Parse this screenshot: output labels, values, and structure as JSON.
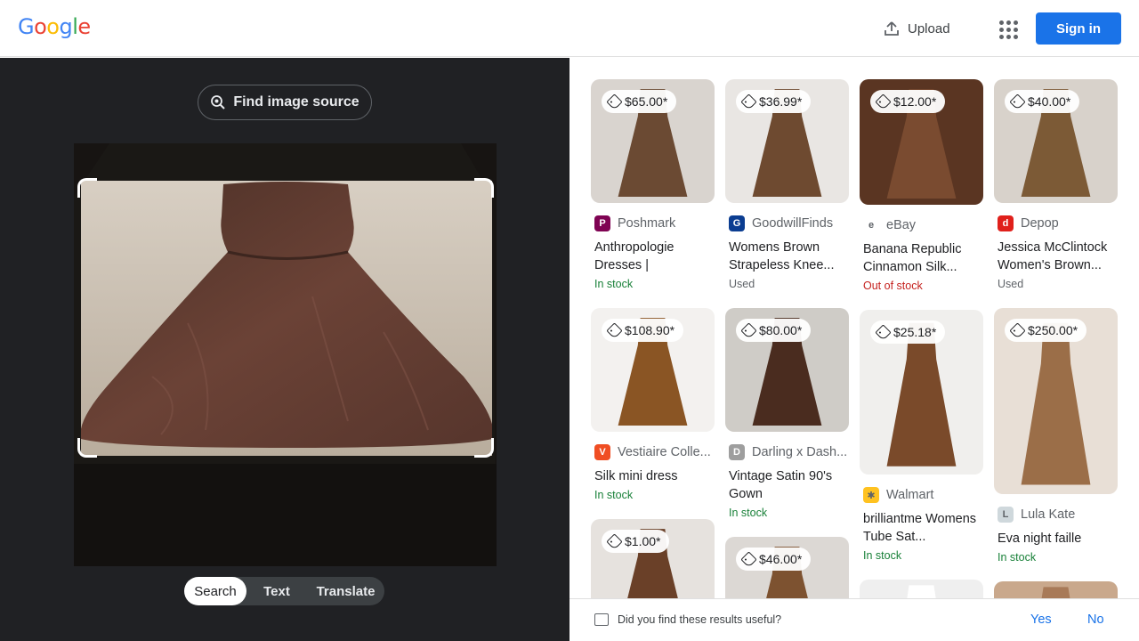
{
  "header": {
    "logo_letters": [
      {
        "ch": "G",
        "color": "#4285f4"
      },
      {
        "ch": "o",
        "color": "#ea4335"
      },
      {
        "ch": "o",
        "color": "#fbbc05"
      },
      {
        "ch": "g",
        "color": "#4285f4"
      },
      {
        "ch": "l",
        "color": "#34a853"
      },
      {
        "ch": "e",
        "color": "#ea4335"
      }
    ],
    "upload_label": "Upload",
    "apps_icon": "apps-grid-icon",
    "signin_label": "Sign in"
  },
  "left": {
    "find_source_label": "Find image source",
    "modes": [
      "Search",
      "Text",
      "Translate"
    ],
    "active_mode": "Search"
  },
  "results": [
    {
      "price": "$65.00*",
      "source": "Poshmark",
      "fav_color": "#7f0353",
      "fav_text": "P",
      "title": "Anthropologie Dresses |",
      "stock": "In stock",
      "stock_type": "in",
      "img": "#d9d4cf",
      "dress": "#6b4a33"
    },
    {
      "price": "$36.99*",
      "source": "GoodwillFinds",
      "fav_color": "#0b3d91",
      "fav_text": "G",
      "title": "Womens Brown Strapeless Knee...",
      "stock": "Used",
      "stock_type": "used",
      "img": "#e9e6e3",
      "dress": "#6e4a30"
    },
    {
      "price": "$12.00*",
      "source": "eBay",
      "fav_color": "#ffffff",
      "fav_text": "e",
      "title": "Banana Republic Cinnamon Silk...",
      "stock": "Out of stock",
      "stock_type": "out",
      "img": "#5a3522",
      "dress": "#7a4b30"
    },
    {
      "price": "$40.00*",
      "source": "Depop",
      "fav_color": "#e0201b",
      "fav_text": "d",
      "title": "Jessica McClintock Women's Brown...",
      "stock": "Used",
      "stock_type": "used",
      "img": "#d8d2cb",
      "dress": "#7c5a36"
    },
    {
      "price": "$108.90*",
      "source": "Vestiaire Colle...",
      "fav_color": "#f04e23",
      "fav_text": "V",
      "title": "Silk mini dress",
      "stock": "In stock",
      "stock_type": "in",
      "img": "#f3f1ef",
      "dress": "#8a5524"
    },
    {
      "price": "$80.00*",
      "source": "Darling x Dash...",
      "fav_color": "#9e9e9e",
      "fav_text": "D",
      "title": "Vintage Satin 90's Gown",
      "stock": "In stock",
      "stock_type": "in",
      "img": "#cfccc7",
      "dress": "#4a2c1f"
    },
    {
      "price": "$25.18*",
      "source": "Walmart",
      "fav_color": "#ffc220",
      "fav_text": "✱",
      "title": "brilliantme Womens Tube Sat...",
      "stock": "In stock",
      "stock_type": "in",
      "img": "#f0efed",
      "dress": "#7a4a2a"
    },
    {
      "price": "$250.00*",
      "source": "Lula Kate",
      "fav_color": "#cfd8dc",
      "fav_text": "L",
      "title": "Eva night faille",
      "stock": "In stock",
      "stock_type": "in",
      "img": "#e8dfd6",
      "dress": "#9b6e48"
    },
    {
      "price": "$1.00*",
      "source": "",
      "fav_color": "",
      "fav_text": "",
      "title": "",
      "stock": "",
      "stock_type": "in",
      "img": "#e6e2de",
      "dress": "#6a4028"
    },
    {
      "price": "$46.00*",
      "source": "",
      "fav_color": "",
      "fav_text": "",
      "title": "",
      "stock": "",
      "stock_type": "in",
      "img": "#dcd8d4",
      "dress": "#7d5230"
    },
    {
      "price": "",
      "source": "",
      "fav_color": "",
      "fav_text": "",
      "title": "",
      "stock": "",
      "stock_type": "in",
      "img": "#efefef",
      "dress": "#ffffff"
    },
    {
      "price": "",
      "source": "",
      "fav_color": "",
      "fav_text": "",
      "title": "",
      "stock": "",
      "stock_type": "in",
      "img": "#c9a88c",
      "dress": "#a87a58"
    }
  ],
  "feedback": {
    "question": "Did you find these results useful?",
    "yes": "Yes",
    "no": "No"
  }
}
